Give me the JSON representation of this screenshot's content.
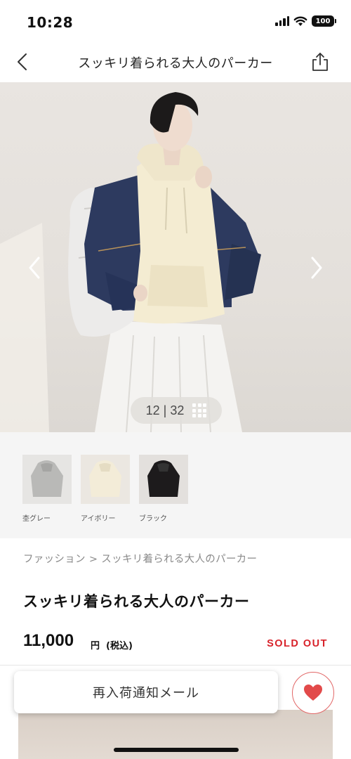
{
  "status_bar": {
    "time": "10:28",
    "battery": "100"
  },
  "nav": {
    "title": "スッキリ着られる大人のパーカー",
    "back_icon": "chevron-left-icon",
    "share_icon": "share-icon"
  },
  "gallery": {
    "counter": "12 | 32"
  },
  "swatches": [
    {
      "label": "杢グレー",
      "color": "#b9b9b7"
    },
    {
      "label": "アイボリー",
      "color": "#f3ecd8"
    },
    {
      "label": "ブラック",
      "color": "#1d1b1c"
    }
  ],
  "breadcrumb": {
    "items": [
      "ファッション",
      "スッキリ着られる大人のパーカー"
    ],
    "separator": ">"
  },
  "product": {
    "title": "スッキリ着られる大人のパーカー",
    "price": "11,000",
    "currency": "円",
    "tax": "(税込)",
    "status": "SOLD OUT"
  },
  "actions": {
    "restock_label": "再入荷通知メール"
  },
  "colors": {
    "accent_red": "#d8222a",
    "heart": "#e24a4a"
  }
}
